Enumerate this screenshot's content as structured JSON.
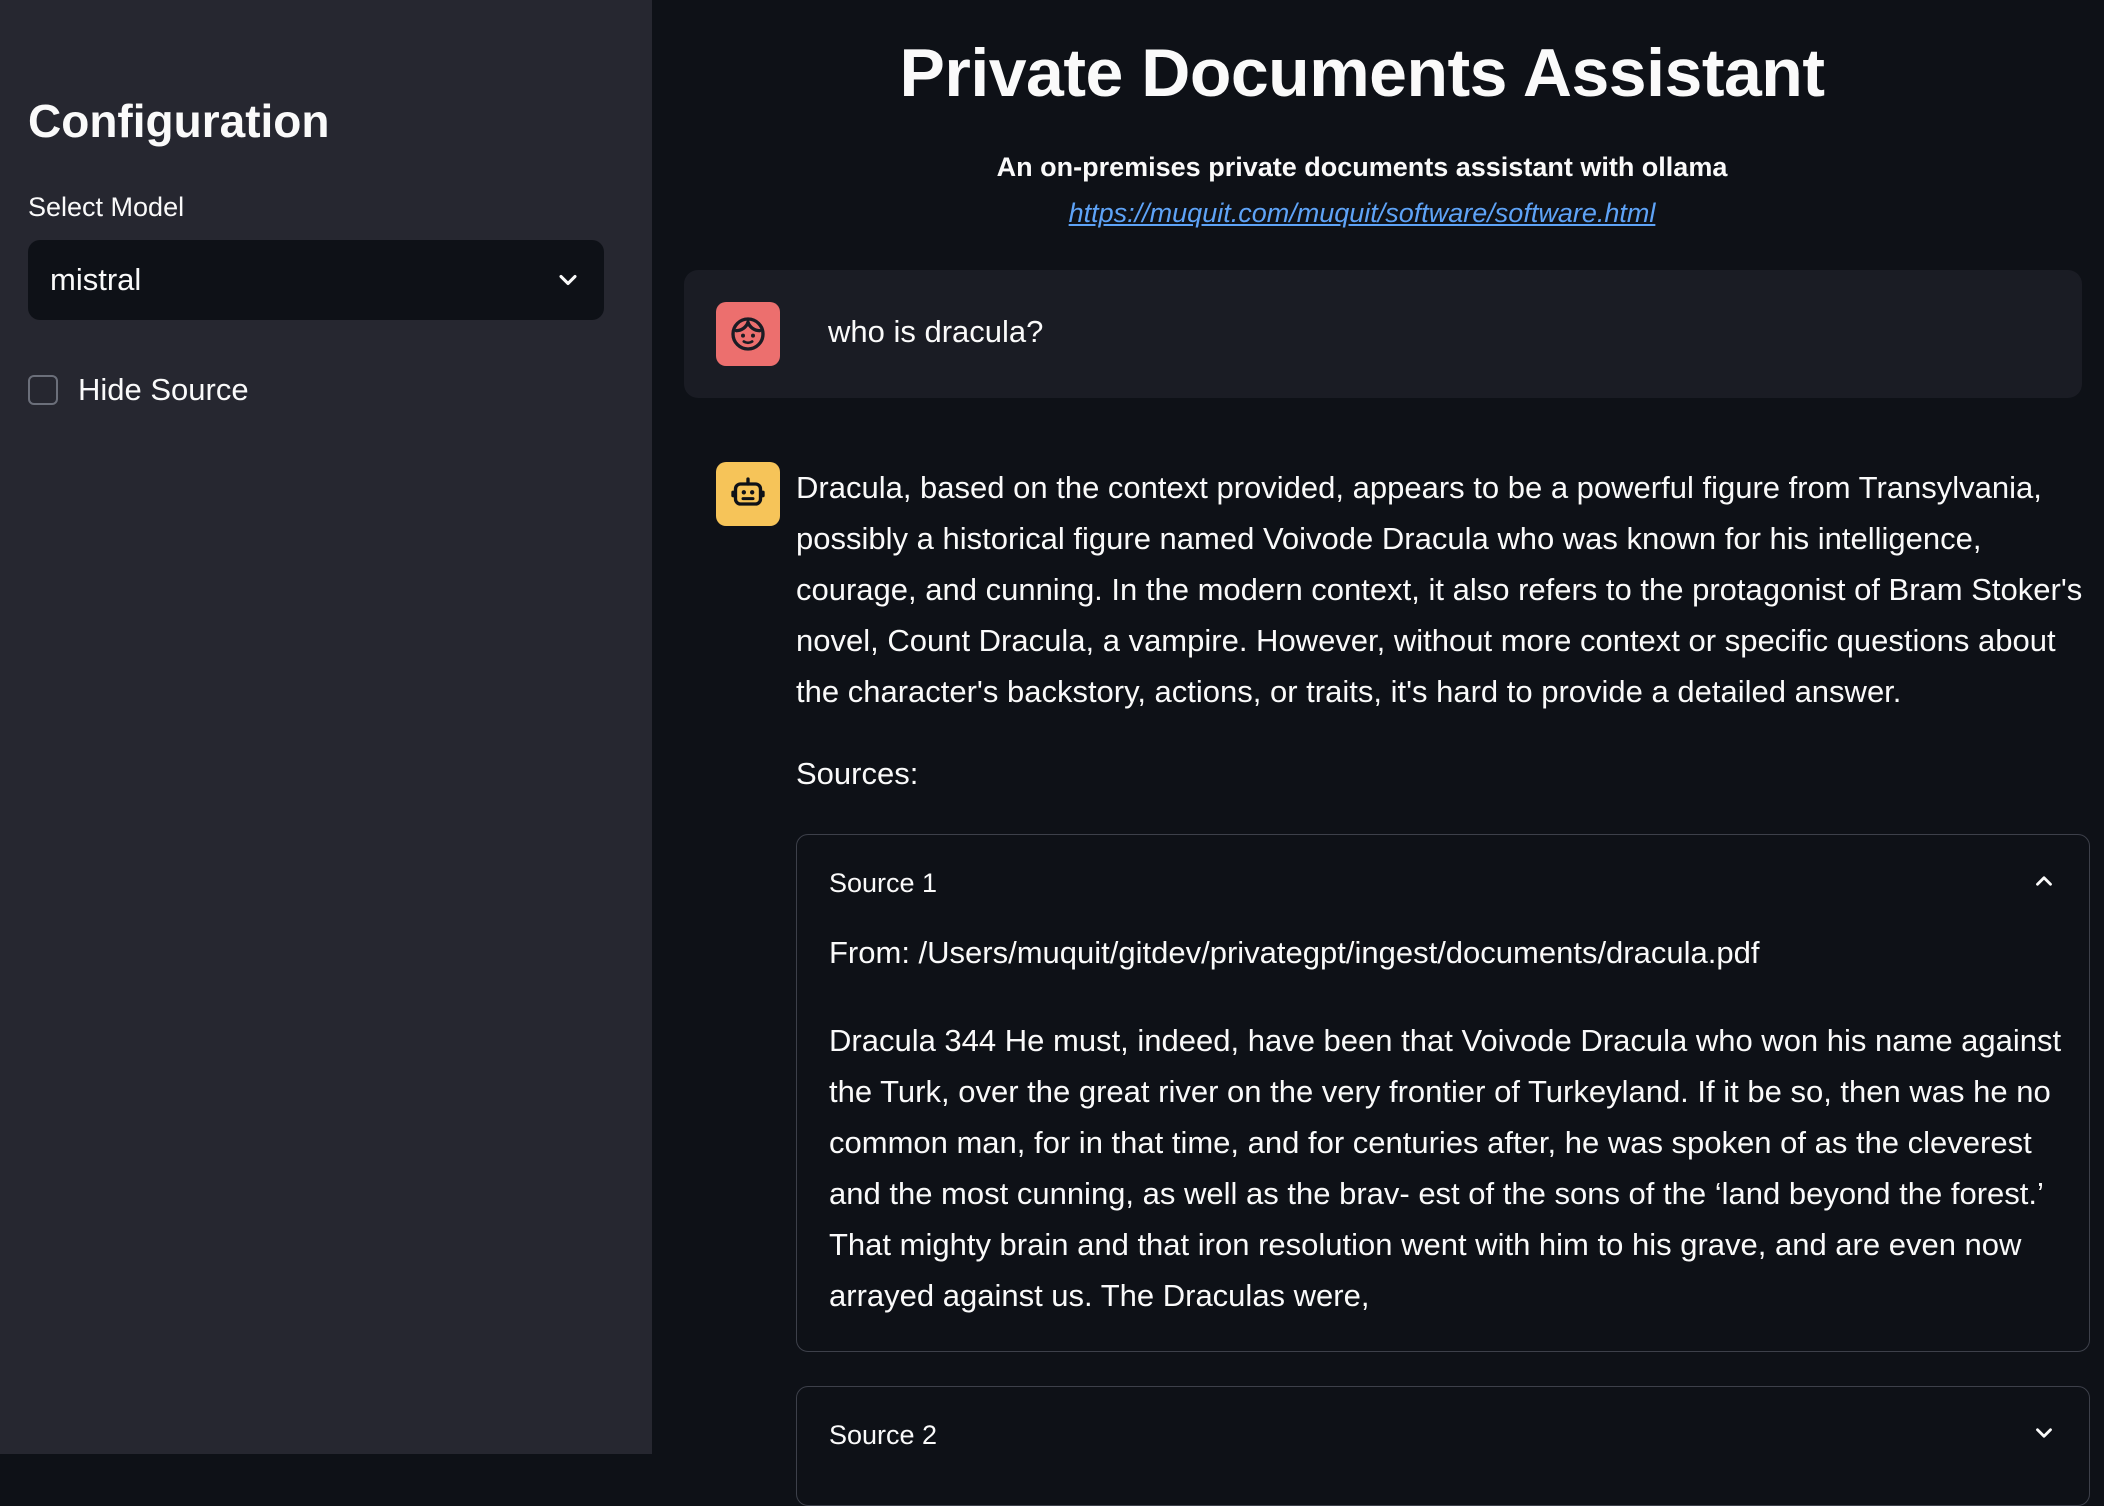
{
  "sidebar": {
    "title": "Configuration",
    "select_label": "Select Model",
    "selected_model": "mistral",
    "hide_source_label": "Hide Source",
    "hide_source_checked": false
  },
  "header": {
    "title": "Private Documents Assistant",
    "subtitle": "An on-premises private documents assistant with ollama",
    "link": "https://muquit.com/muquit/software/software.html"
  },
  "chat": {
    "user_message": "who is dracula?",
    "assistant_message": "Dracula, based on the context provided, appears to be a powerful figure from Transylvania, possibly a historical figure named Voivode Dracula who was known for his intelligence, courage, and cunning. In the modern context, it also refers to the protagonist of Bram Stoker's novel, Count Dracula, a vampire. However, without more context or specific questions about the character's backstory, actions, or traits, it's hard to provide a detailed answer.",
    "sources_label": "Sources:",
    "sources": [
      {
        "title": "Source 1",
        "expanded": true,
        "from": "From: /Users/muquit/gitdev/privategpt/ingest/documents/dracula.pdf",
        "content": "Dracula 344 He must, indeed, have been that Voivode Dracula who won his name against the Turk, over the great river on the very frontier of Turkeyland. If it be so, then was he no common man, for in that time, and for centuries after, he was spoken of as the cleverest and the most cunning, as well as the brav- est of the sons of the ‘land beyond the forest.’ That mighty brain and that iron resolution went with him to his grave, and are even now arrayed against us. The Draculas were,"
      },
      {
        "title": "Source 2",
        "expanded": false
      }
    ]
  },
  "colors": {
    "sidebar_bg": "#262730",
    "main_bg": "#0e1117",
    "link": "#5ea3f7",
    "user_avatar": "#ec6f6e",
    "bot_avatar": "#f6c459"
  },
  "icons": {
    "select_chevron": "chevron-down-icon",
    "user_avatar": "user-face-icon",
    "bot_avatar": "robot-icon",
    "source1_toggle": "chevron-up-icon",
    "source2_toggle": "chevron-down-icon"
  }
}
